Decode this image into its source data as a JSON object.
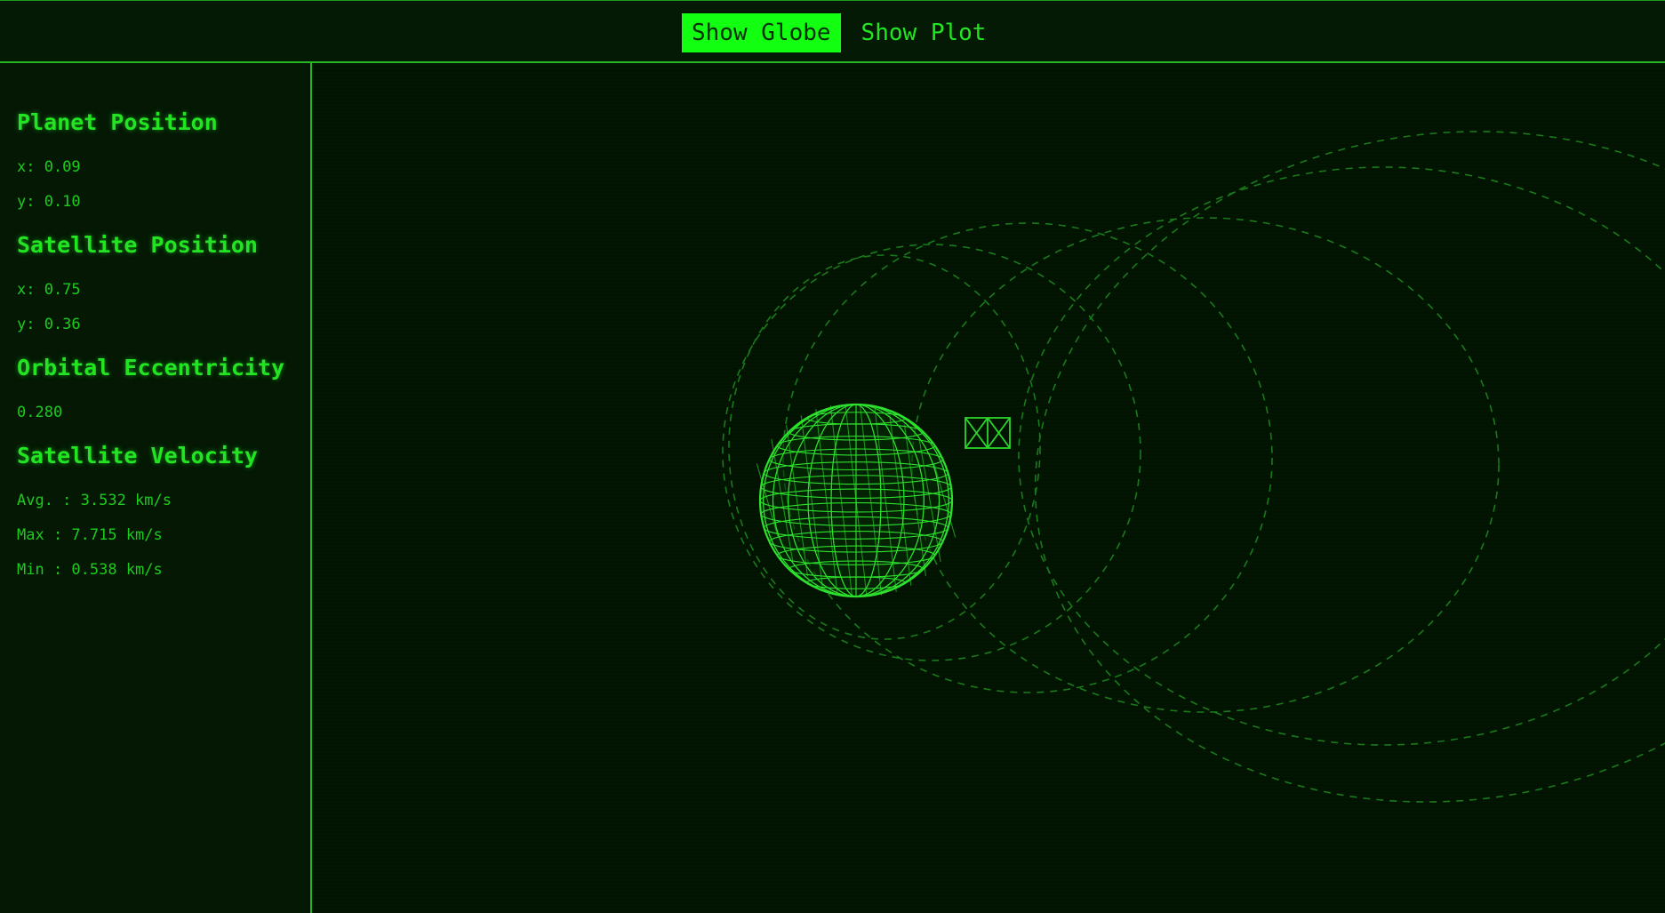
{
  "tabs": [
    {
      "label": "Show Globe",
      "active": true
    },
    {
      "label": "Show Plot",
      "active": false
    }
  ],
  "sidebar": {
    "planet": {
      "title": "Planet Position",
      "x": "x: 0.09",
      "y": "y: 0.10"
    },
    "satellite": {
      "title": "Satellite Position",
      "x": "x: 0.75",
      "y": "y: 0.36"
    },
    "eccentricity": {
      "title": "Orbital Eccentricity",
      "value": "0.280"
    },
    "velocity": {
      "title": "Satellite Velocity",
      "avg": "Avg. : 3.532 km/s",
      "max": "Max : 7.715 km/s",
      "min": "Min : 0.538 km/s"
    }
  },
  "icons": {
    "planet": "wireframe-globe-icon",
    "satellite": "satellite-icon"
  },
  "colors": {
    "background": "#031603",
    "accent": "#12ff12",
    "text": "#1fd11f",
    "orbit": "#1a7a1a"
  }
}
